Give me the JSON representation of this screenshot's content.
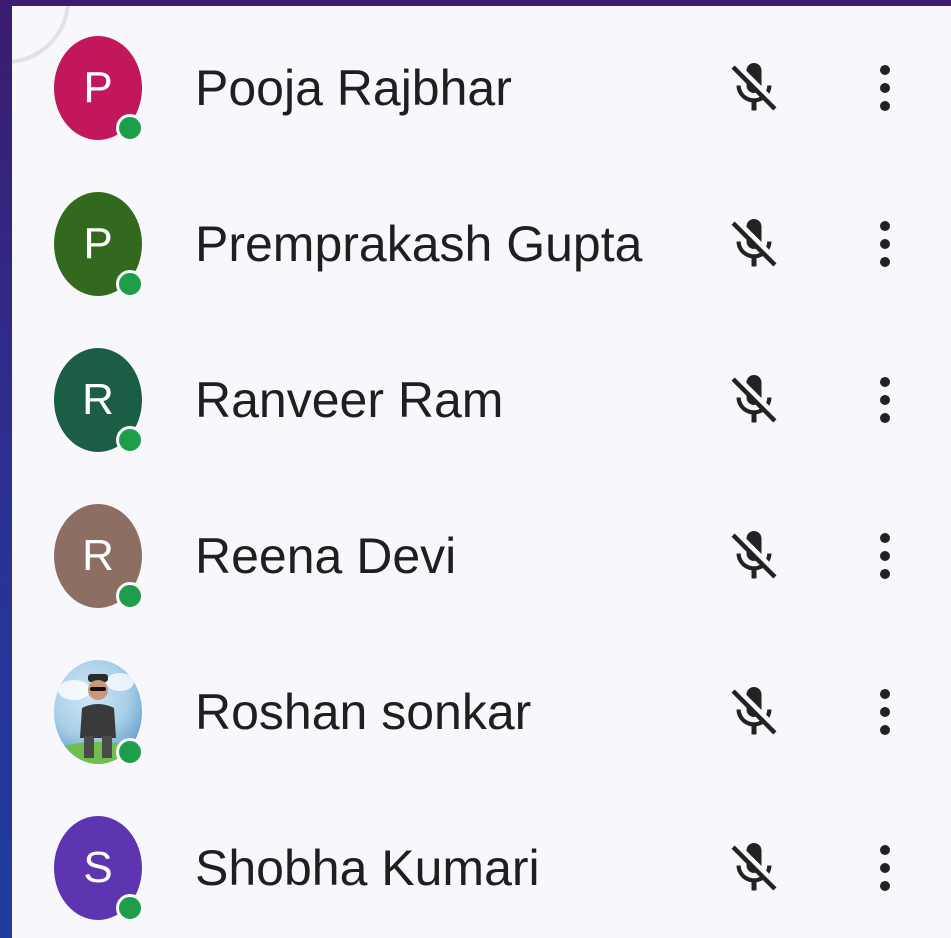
{
  "participants": [
    {
      "initial": "P",
      "name": "Pooja Rajbhar",
      "avatar_color": "#c2185b",
      "avatar_type": "initial",
      "online": true,
      "muted": true
    },
    {
      "initial": "P",
      "name": "Premprakash Gupta",
      "avatar_color": "#33691e",
      "avatar_type": "initial",
      "online": true,
      "muted": true
    },
    {
      "initial": "R",
      "name": "Ranveer Ram",
      "avatar_color": "#1b5e45",
      "avatar_type": "initial",
      "online": true,
      "muted": true
    },
    {
      "initial": "R",
      "name": "Reena Devi",
      "avatar_color": "#8d6e63",
      "avatar_type": "initial",
      "online": true,
      "muted": true
    },
    {
      "initial": "",
      "name": "Roshan sonkar",
      "avatar_color": "#8fbfe0",
      "avatar_type": "photo",
      "online": true,
      "muted": true
    },
    {
      "initial": "S",
      "name": "Shobha Kumari",
      "avatar_color": "#5e35b1",
      "avatar_type": "initial",
      "online": true,
      "muted": true
    }
  ],
  "icons": {
    "mute": "mic-off-icon",
    "more": "more-vert-icon"
  },
  "colors": {
    "online": "#1e9e4a",
    "panel_bg": "#f8f7fb",
    "text": "#1f1f1f"
  }
}
